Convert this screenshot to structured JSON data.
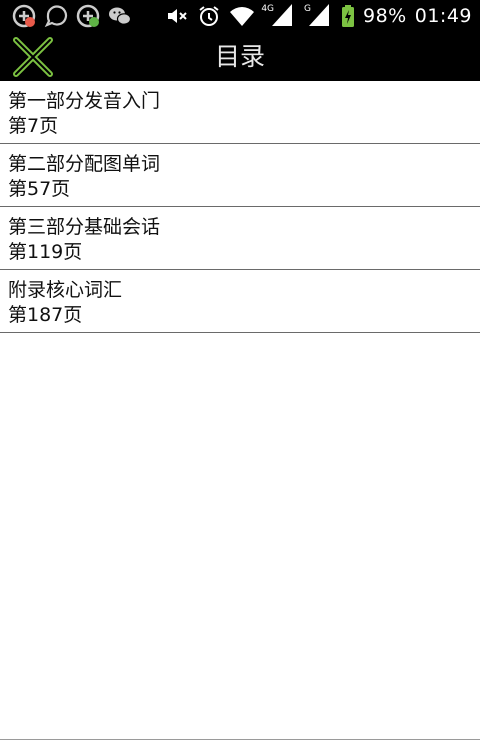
{
  "status_bar": {
    "battery_percent": "98%",
    "time": "01:49",
    "network_type_1": "4G",
    "network_type_2": "G",
    "icons": [
      "notification-app-icon",
      "chat-bubble-icon",
      "notification-app-icon",
      "wechat-icon",
      "mute-icon",
      "alarm-icon",
      "wifi-icon",
      "signal-icon",
      "signal-icon",
      "battery-charging-icon"
    ]
  },
  "header": {
    "title": "目录",
    "close_icon": "close-x-icon",
    "accent": "#7cc242"
  },
  "toc": {
    "items": [
      {
        "title": "第一部分发音入门",
        "page": "第7页"
      },
      {
        "title": "第二部分配图单词",
        "page": "第57页"
      },
      {
        "title": "第三部分基础会话",
        "page": "第119页"
      },
      {
        "title": "附录核心词汇",
        "page": "第187页"
      }
    ]
  }
}
